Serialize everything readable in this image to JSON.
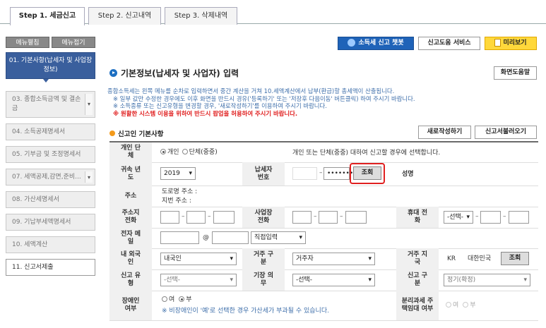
{
  "tabs": [
    "Step 1. 세금신고",
    "Step 2. 신고내역",
    "Step 3. 삭제내역"
  ],
  "sidebar": {
    "expand": "메뉴펼침",
    "collapse": "메뉴접기",
    "items": [
      {
        "label": "01. 기본사항(납세자 및 사업장정보)"
      },
      {
        "label": "03. 종합소득금액 및 결손금"
      },
      {
        "label": "04. 소득공제명세서"
      },
      {
        "label": "05. 기부금 및 조정명세서"
      },
      {
        "label": "07. 세액공제,감면,준비..."
      },
      {
        "label": "08. 가산세명세서"
      },
      {
        "label": "09. 기납부세액명세서"
      },
      {
        "label": "10. 세액계산"
      },
      {
        "label": "11. 신고서제출"
      }
    ]
  },
  "toolbar": {
    "chatbot": "소득세 신고 챗봇",
    "help_service": "신고도움 서비스",
    "preview": "미리보기",
    "screen_help": "화면도움말",
    "new_write": "새로작성하기",
    "load": "신고서불러오기"
  },
  "page": {
    "title": "기본정보(납세자 및 사업자) 입력",
    "desc1": "종합소득세는 왼쪽 메뉴를 순차로 입력하면서 중간 계산을 거쳐 10.세액계산에서 납부(환급)할 총세액이 산출됩니다.",
    "desc2": "※ 일부 값만 수정한 경우에도 이후 화면을 반드시 경유('등록하기' 또는 '저장후 다음이동' 버튼클릭) 하여 주시기 바랍니다.",
    "desc3": "※ 소득종류 또는 신고유형을 변경할 경우, '새로작성하기'를 이용하여 주시기 바랍니다.",
    "desc4": "※ 원활한 시스템 이용을 위하여 반드시 팝업을 허용하여 주시기 바랍니다.",
    "section": "신고인 기본사항"
  },
  "form": {
    "labels": {
      "type": "개인 단체",
      "year": "귀속 년도",
      "taxpayer_id": "납세자 번호",
      "name": "성명",
      "address": "주소",
      "home_phone": "주소지 전화",
      "biz_phone": "사업장 전화",
      "mobile": "휴대 전화",
      "email": "전자 메일",
      "resident": "내 외국인",
      "residence": "거주 구분",
      "country": "거주 지국",
      "report_type": "신고 유형",
      "booking": "기장 의무",
      "report_kind": "신고 구분",
      "disabled": "장애인 여부",
      "separate": "분리과세 주택임대 여부"
    },
    "type_personal": "개인",
    "type_group": "단체(중중)",
    "type_note": "개인 또는 단체(중중) 대하여 신고할 경우에 선택합니다.",
    "year": "2019",
    "id_mask": "•••••••",
    "lookup": "조회",
    "road_address": "도로명 주소 :",
    "lot_address": "지번 주소 :",
    "mobile_select": "-선택-",
    "at": "@",
    "email_direct": "직접입력",
    "resident_value": "내국인",
    "residence_value": "거주자",
    "country_code": "KR",
    "country_name": "대한민국",
    "report_type_value": "-선택-",
    "booking_value": "-선택-",
    "report_kind_value": "정기(확정)",
    "yes": "여",
    "no": "부",
    "disabled_note": "※ 비장애인이 '예'로 선택한 경우 가산세가 부과될 수 있습니다."
  }
}
